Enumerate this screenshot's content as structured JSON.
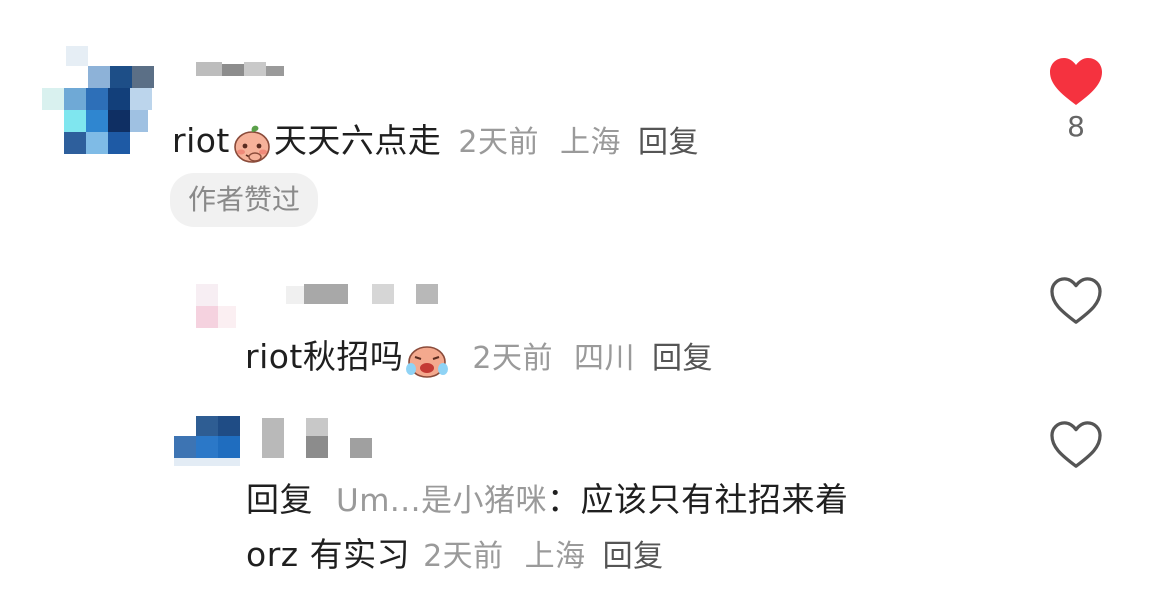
{
  "comments": [
    {
      "text_prefix": "riot",
      "emoji": "blush-peach-emoji",
      "text_suffix": "天天六点走",
      "time": "2天前",
      "location": "上海",
      "reply_label": "回复",
      "badge": "作者赞过",
      "liked": true,
      "likes": "8"
    },
    {
      "text_prefix": "riot秋招吗",
      "emoji": "crying-emoji",
      "time": "2天前",
      "location": "四川",
      "reply_label": "回复",
      "liked": false
    },
    {
      "reply_prefix": "回复",
      "reply_to": "Um...是小猪咪",
      "text_line1": "：应该只有社招来着",
      "text_line2": "orz 有实习",
      "time": "2天前",
      "location": "上海",
      "reply_label": "回复",
      "liked": false
    }
  ],
  "colors": {
    "like_active": "#f5323f",
    "like_inactive": "#555555"
  }
}
